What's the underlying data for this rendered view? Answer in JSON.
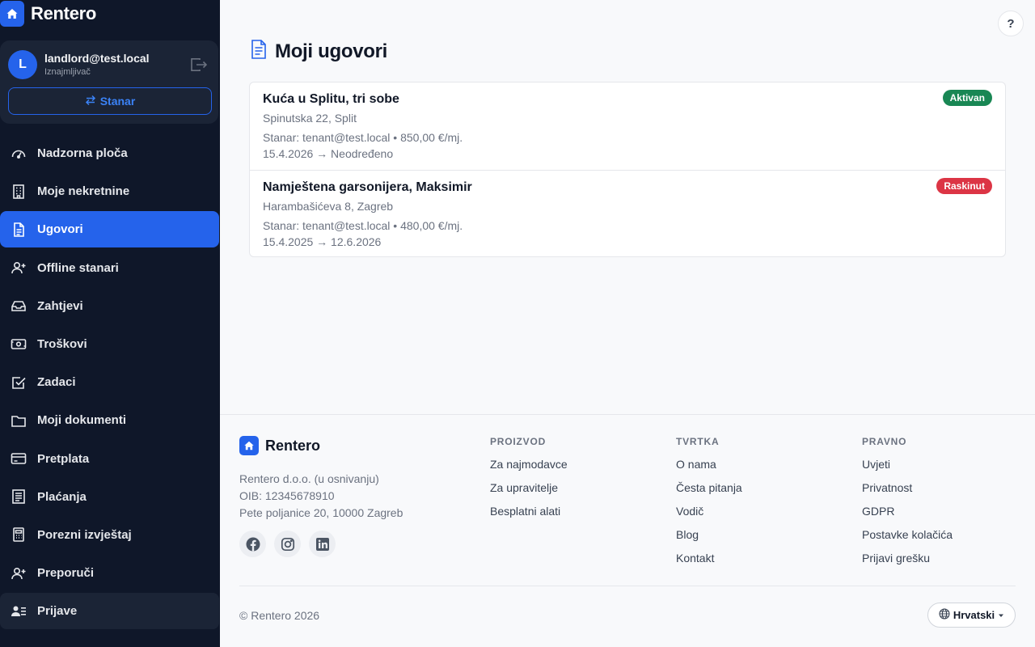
{
  "app": {
    "name": "Rentero"
  },
  "user": {
    "initial": "L",
    "email": "landlord@test.local",
    "role": "Iznajmljivač",
    "switch_label": "Stanar"
  },
  "sidebar": {
    "items": [
      {
        "label": "Nadzorna ploča",
        "icon": "dashboard-icon"
      },
      {
        "label": "Moje nekretnine",
        "icon": "building-icon"
      },
      {
        "label": "Ugovori",
        "icon": "document-icon",
        "active": true
      },
      {
        "label": "Offline stanari",
        "icon": "user-plus-icon"
      },
      {
        "label": "Zahtjevi",
        "icon": "inbox-icon"
      },
      {
        "label": "Troškovi",
        "icon": "cash-icon"
      },
      {
        "label": "Zadaci",
        "icon": "checkbox-icon"
      },
      {
        "label": "Moji dokumenti",
        "icon": "folder-icon"
      },
      {
        "label": "Pretplata",
        "icon": "credit-card-icon"
      },
      {
        "label": "Plaćanja",
        "icon": "receipt-icon"
      },
      {
        "label": "Porezni izvještaj",
        "icon": "calculator-icon"
      },
      {
        "label": "Preporuči",
        "icon": "user-plus-icon"
      },
      {
        "label": "Prijave",
        "icon": "user-list-icon"
      }
    ]
  },
  "help_label": "?",
  "page": {
    "title": "Moji ugovori"
  },
  "contracts": [
    {
      "title": "Kuća u Splitu, tri sobe",
      "address": "Spinutska 22, Split",
      "meta": "Stanar: tenant@test.local • 850,00 €/mj.",
      "dates": "15.4.2026 → Neodređeno",
      "status": "Aktivan",
      "status_color": "#198754"
    },
    {
      "title": "Namještena garsonijera, Maksimir",
      "address": "Harambašićeva 8, Zagreb",
      "meta": "Stanar: tenant@test.local • 480,00 €/mj.",
      "dates": "15.4.2025 → 12.6.2026",
      "status": "Raskinut",
      "status_color": "#dc3545"
    }
  ],
  "footer": {
    "brand": "Rentero",
    "company_lines": [
      "Rentero d.o.o. (u osnivanju)",
      "OIB: 12345678910",
      "Pete poljanice 20, 10000 Zagreb"
    ],
    "columns": [
      {
        "heading": "PROIZVOD",
        "links": [
          "Za najmodavce",
          "Za upravitelje",
          "Besplatni alati"
        ]
      },
      {
        "heading": "TVRTKA",
        "links": [
          "O nama",
          "Česta pitanja",
          "Vodič",
          "Blog",
          "Kontakt"
        ]
      },
      {
        "heading": "PRAVNO",
        "links": [
          "Uvjeti",
          "Privatnost",
          "GDPR",
          "Postavke kolačića",
          "Prijavi grešku"
        ]
      }
    ],
    "copyright": "© Rentero 2026",
    "language": "Hrvatski"
  },
  "colors": {
    "accent": "#2563eb",
    "sidebar_bg": "#0f1729"
  }
}
